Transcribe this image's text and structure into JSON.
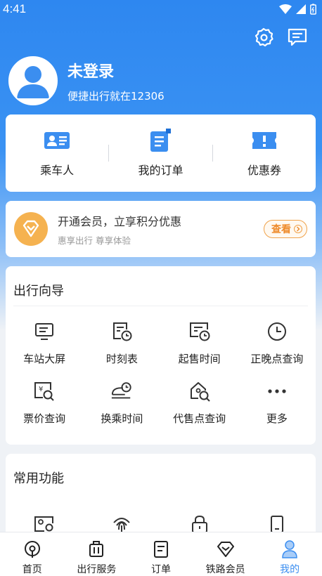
{
  "status_bar": {
    "time": "4:41"
  },
  "profile": {
    "name": "未登录",
    "subtitle": "便捷出行就在12306"
  },
  "top_actions": [
    {
      "name": "settings",
      "icon": "gear-icon"
    },
    {
      "name": "messages",
      "icon": "message-icon"
    }
  ],
  "quick_actions": [
    {
      "label": "乘车人",
      "icon": "passenger-card-icon"
    },
    {
      "label": "我的订单",
      "icon": "order-document-icon"
    },
    {
      "label": "优惠券",
      "icon": "coupon-ticket-icon"
    }
  ],
  "member": {
    "title": "开通会员，立享积分优惠",
    "subtitle": "惠享出行 尊享体验",
    "button": "查看",
    "badge_color": "#f5b250"
  },
  "guide": {
    "title": "出行向导",
    "items": [
      {
        "label": "车站大屏",
        "icon": "display-board-icon"
      },
      {
        "label": "时刻表",
        "icon": "timetable-icon"
      },
      {
        "label": "起售时间",
        "icon": "sale-time-icon"
      },
      {
        "label": "正晚点查询",
        "icon": "clock-icon"
      },
      {
        "label": "票价查询",
        "icon": "fare-search-icon"
      },
      {
        "label": "换乘时间",
        "icon": "transfer-train-icon"
      },
      {
        "label": "代售点查询",
        "icon": "agency-search-icon"
      },
      {
        "label": "更多",
        "icon": "more-dots-icon"
      }
    ]
  },
  "common": {
    "title": "常用功能",
    "items": [
      {
        "icon": "id-card-search-icon"
      },
      {
        "icon": "fingerprint-icon"
      },
      {
        "icon": "lock-icon"
      },
      {
        "icon": "phone-icon"
      }
    ]
  },
  "bottom_nav": [
    {
      "label": "首页",
      "icon": "home-train-icon"
    },
    {
      "label": "出行服务",
      "icon": "luggage-icon"
    },
    {
      "label": "订单",
      "icon": "order-list-icon"
    },
    {
      "label": "铁路会员",
      "icon": "diamond-icon"
    },
    {
      "label": "我的",
      "icon": "user-icon",
      "active": true
    }
  ],
  "colors": {
    "primary": "#3b8ef0",
    "accent_orange": "#ee8a2a",
    "gradient_top": "#2e87f0"
  }
}
